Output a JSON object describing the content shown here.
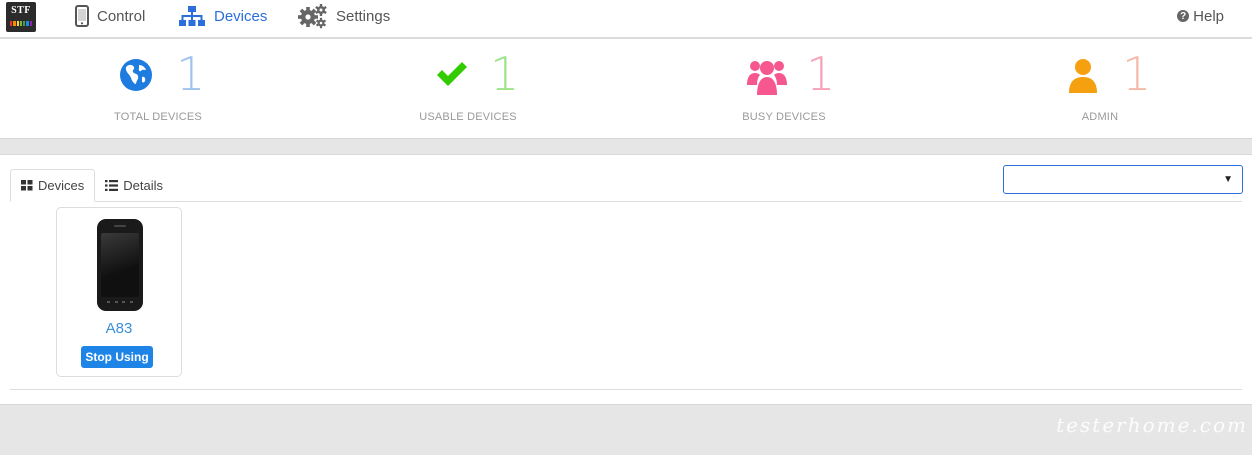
{
  "navbar": {
    "logo_text": "STF",
    "logo_bar_colors": [
      "#e53935",
      "#fb8c00",
      "#fdd835",
      "#7cb342",
      "#43a047",
      "#1e88e5",
      "#8e24aa"
    ],
    "items": [
      {
        "label": "Control",
        "icon": "mobile-phone-icon",
        "active": false
      },
      {
        "label": "Devices",
        "icon": "sitemap-icon",
        "active": true
      },
      {
        "label": "Settings",
        "icon": "gears-icon",
        "active": false
      }
    ],
    "help_label": "Help",
    "active_color": "#2a6fdb"
  },
  "stats": [
    {
      "value": "1",
      "label": "TOTAL DEVICES",
      "icon": "globe-icon",
      "icon_color": "#1e7be0",
      "num_color": "#9ec3ee"
    },
    {
      "value": "1",
      "label": "USABLE DEVICES",
      "icon": "check-icon",
      "icon_color": "#33cc00",
      "num_color": "#9de389"
    },
    {
      "value": "1",
      "label": "BUSY DEVICES",
      "icon": "users-icon",
      "icon_color": "#f5578e",
      "num_color": "#f6a1b8"
    },
    {
      "value": "1",
      "label": "ADMIN",
      "icon": "user-icon",
      "icon_color": "#f5a00f",
      "num_color": "#f6b9a8"
    }
  ],
  "devices_panel": {
    "tabs": [
      {
        "label": "Devices",
        "icon": "th-large-icon",
        "active": true
      },
      {
        "label": "Details",
        "icon": "list-icon",
        "active": false
      }
    ],
    "filter_select": {
      "value": "",
      "caret": "▼"
    },
    "devices": [
      {
        "name": "A83",
        "action_label": "Stop Using"
      }
    ]
  },
  "watermark": "testerhome.com"
}
